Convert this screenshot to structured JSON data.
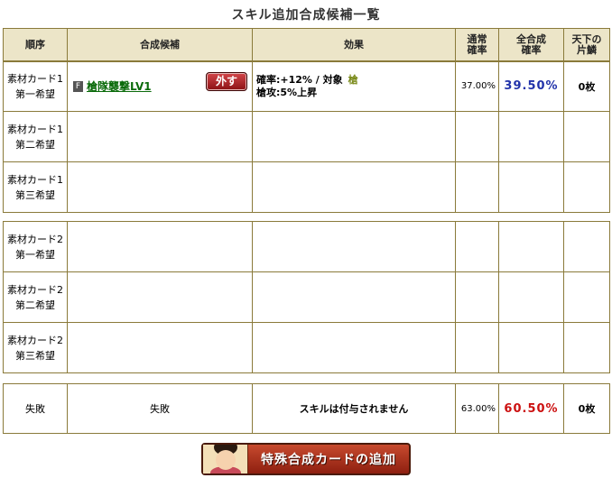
{
  "page": {
    "title": "スキル追加合成候補一覧"
  },
  "header": {
    "order": "順序",
    "candidate": "合成候補",
    "effect": "効果",
    "base_rate_1": "通常",
    "base_rate_2": "確率",
    "total_rate_1": "全合成",
    "total_rate_2": "確率",
    "fragments_1": "天下の",
    "fragments_2": "片鱗"
  },
  "groups": [
    {
      "rows": [
        {
          "order_1": "素材カード1",
          "order_2": "第一希望",
          "grade": "F",
          "skill": "槍隊襲撃LV1",
          "remove_label": "外す",
          "effect_line1": "確率:+12% / 対象",
          "effect_target": "槍",
          "effect_line2": "槍攻:5%上昇",
          "base_rate": "37.00%",
          "total_rate": "39.50%",
          "fragments": "0枚"
        },
        {
          "order_1": "素材カード1",
          "order_2": "第二希望"
        },
        {
          "order_1": "素材カード1",
          "order_2": "第三希望"
        }
      ]
    },
    {
      "rows": [
        {
          "order_1": "素材カード2",
          "order_2": "第一希望"
        },
        {
          "order_1": "素材カード2",
          "order_2": "第二希望"
        },
        {
          "order_1": "素材カード2",
          "order_2": "第三希望"
        }
      ]
    }
  ],
  "failure": {
    "order": "失敗",
    "candidate": "失敗",
    "effect": "スキルは付与されません",
    "base_rate": "63.00%",
    "total_rate": "60.50%",
    "fragments": "0枚"
  },
  "add_card_button": {
    "label": "特殊合成カードの追加"
  },
  "colors": {
    "header_bg": "#ece5c8",
    "border": "#8a7a3a",
    "skill_link": "#0b6b0b",
    "total_success": "#2233aa",
    "total_failure": "#cc1111"
  }
}
